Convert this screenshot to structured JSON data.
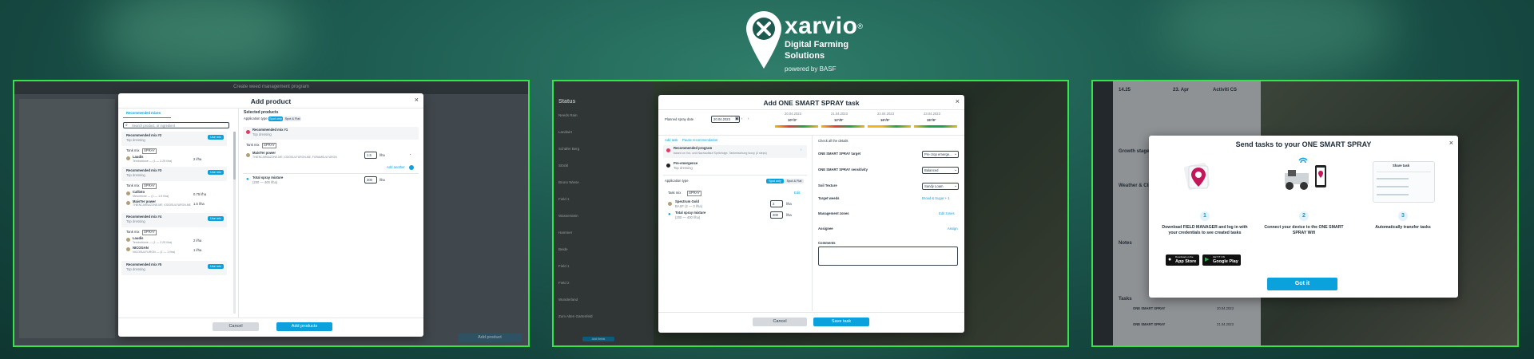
{
  "header": {
    "brand": "xarvio",
    "registered": "®",
    "line1": "Digital Farming",
    "line2": "Solutions",
    "powered": "powered by BASF"
  },
  "colors": {
    "accent": "#0aa1dd",
    "frame": "#35e34a",
    "brand_bg": "#1d5a50"
  },
  "p1": {
    "bg_title": "Create weed management program",
    "title": "Add product",
    "tab": "Recommended mixes",
    "search_placeholder": "Search product, or ingredient",
    "mixes": [
      {
        "name": "Recommended mix #2",
        "sub": "Top dressing",
        "use": "Use mix",
        "tankmix": "Tank mix",
        "tag": "SPRAY",
        "products": [
          {
            "name": "Laudis",
            "desc": "Tembotrione — (1 — 2.25 l/ha)",
            "rate": "2 l/ha"
          }
        ]
      },
      {
        "name": "Recommended mix #3",
        "sub": "Top dressing",
        "use": "Use mix",
        "tankmix": "Tank mix",
        "tag": "SPRAY",
        "products": [
          {
            "name": "Callisto",
            "desc": "Mesotrione — (1 — 1.5 l/ha)",
            "rate": "0.75 l/ha"
          },
          {
            "name": "MaisTer power",
            "desc": "THIENCARBAZONE-ME, IODOSULFURON-ME",
            "rate": "1.5 l/ha"
          }
        ]
      },
      {
        "name": "Recommended mix #4",
        "sub": "Top dressing",
        "use": "Use mix",
        "tankmix": "Tank mix",
        "tag": "SPRAY",
        "products": [
          {
            "name": "Laudis",
            "desc": "Tembotrione — (1 — 2.25 l/ha)",
            "rate": "2 l/ha"
          },
          {
            "name": "NICOGAN",
            "desc": "NICOSULFURON — (1 — 1 l/ha)",
            "rate": "1 l/ha"
          }
        ]
      },
      {
        "name": "Recommended mix #5",
        "sub": "Top dressing",
        "use": "Use mix"
      }
    ],
    "selected_title": "Selected products",
    "application_type": "Application type:",
    "opt1": "Spot only",
    "opt2": "Spot & Flat",
    "sel_mix": "Recommended mix #1",
    "sel_sub": "Top dressing",
    "tankmix": "Tank mix",
    "tag": "SPRAY",
    "sel_product": "MaisTer power",
    "sel_desc": "THIENCARBAZONE-ME, IODOSULFURON-ME, FORAMSULFURON",
    "sel_rate": "1.5",
    "unit": "l/ha",
    "add_another": "Add another",
    "total": "Total spray mixture",
    "total_range": "(200 — 400 l/ha)",
    "total_val": "300",
    "cancel": "Cancel",
    "add": "Add products",
    "bg_btn": "Add product"
  },
  "p2": {
    "title": "Add ONE SMART SPRAY task",
    "status": "Status",
    "crumb": "Add task",
    "pause": "Pause recommendation",
    "planned_label": "Planned spray date",
    "date": "20.04.2023",
    "days": [
      {
        "d": "20.04.2023",
        "t": "10°/3°"
      },
      {
        "d": "21.04.2023",
        "t": "12°/8°"
      },
      {
        "d": "22.04.2023",
        "t": "16°/9°"
      },
      {
        "d": "23.04.2023",
        "t": "15°/9°"
      }
    ],
    "rec_prog": "Recommended program",
    "rec_sub": "based on Vor- und Nachauflauf Spritzfolge, Tankmischung Isoxy (2 steps)",
    "pre": "Pre-emergence",
    "pre_sub": "Top dressing",
    "app_type": "Application type",
    "opt1": "Spot only",
    "opt2": "Spot & Flat",
    "tankmix": "Task mix",
    "tag": "SPRAY",
    "edit": "Edit",
    "prod1": "Spectrum Gold",
    "prod1_sub": "BASF (2 — 3 l/ha)",
    "prod1_val": "2",
    "prod2": "Total spray mixture",
    "prod2_sub": "(200 — 400 l/ha)",
    "prod2_val": "200",
    "unit": "l/ha",
    "check": "Check all the details",
    "fields": [
      {
        "label": "ONE SMART SPRAY target",
        "value": "Pre crop emerge..."
      },
      {
        "label": "ONE SMART SPRAY sensitivity",
        "value": "Balanced"
      },
      {
        "label": "Soil Texture",
        "value": "Sandy Loam"
      }
    ],
    "target_weeds": "Target weeds",
    "target_val": "Broad & Sugar + 1",
    "zones": "Management zones",
    "zones_val": "Edit zones",
    "assignee": "Assignee",
    "assignee_val": "Assign",
    "comments": "Comments",
    "cancel": "Cancel",
    "save": "Save task",
    "side": [
      "Needs Rain",
      "Landwirt",
      "Schäfer Berg",
      "Stöckl",
      "Bruno Wiese",
      "Field 1",
      "Wasserstein",
      "Hammer",
      "Beide",
      "Field 1",
      "Field 2",
      "Wunderland",
      "Zum Alten Gartenfeld"
    ],
    "side_btn": "Add fields"
  },
  "p3": {
    "title": "Send tasks to your ONE SMART SPRAY",
    "steps": [
      {
        "n": "1",
        "text": "Download FIELD MANAGER and log in with your credentials to see created tasks"
      },
      {
        "n": "2",
        "text": "Connect your device to the ONE SMART SPRAY Wifi"
      },
      {
        "n": "3",
        "text": "Automatically transfer tasks"
      }
    ],
    "appstore_small": "Download on the",
    "appstore": "App Store",
    "play_small": "GET IT ON",
    "play": "Google Play",
    "share": "Share task",
    "got_it": "Got it",
    "bg": {
      "temp": "14.25",
      "date": "23. Apr",
      "act": "Activiti CS",
      "stage": "Growth stage",
      "weather": "Weather & Cli",
      "notes": "Notes",
      "tasks": "Tasks",
      "task1": "ONE SMART SPRAY",
      "task2": "ONE SMART SPRAY",
      "d1": "20.04.2023",
      "d2": "21.04.2023"
    }
  }
}
